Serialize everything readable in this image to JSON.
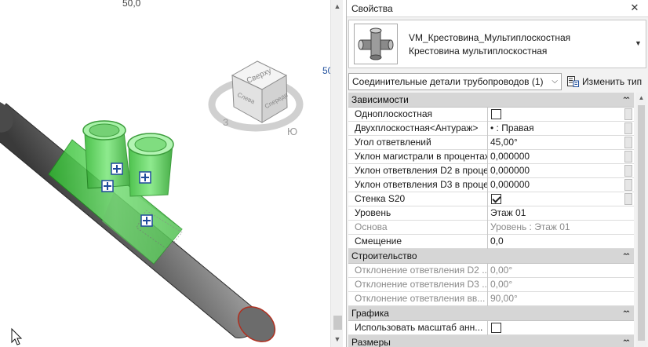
{
  "viewport": {
    "dim_top": "50,0",
    "dim_right": "50",
    "viewcube": {
      "face_top": "Сверху",
      "face_front": "Спереди",
      "face_left": "Слева",
      "compass_west": "З",
      "compass_south": "Ю"
    }
  },
  "properties": {
    "title": "Свойства",
    "type_name_1": "VM_Крестовина_Мультиплоскостная",
    "type_name_2": "Крестовина мультиплоскостная",
    "filter": "Соединительные детали трубопроводов (1)",
    "edit_type": "Изменить тип",
    "groups": [
      {
        "label": "Зависимости",
        "rows": [
          {
            "name": "Одноплоскостная",
            "type": "checkbox",
            "checked": false,
            "disabled": false
          },
          {
            "name": "Двухплоскостная<Антураж>",
            "value": "• : Правая",
            "disabled": false
          },
          {
            "name": "Угол ответвлений",
            "value": "45,00°",
            "disabled": false
          },
          {
            "name": "Уклон магистрали в процентах",
            "value": "0,000000",
            "disabled": false
          },
          {
            "name": "Уклон ответвления D2 в процентах",
            "value": "0,000000",
            "disabled": false
          },
          {
            "name": "Уклон ответвления D3 в процентах",
            "value": "0,000000",
            "disabled": false
          },
          {
            "name": "Стенка S20",
            "type": "checkbox",
            "checked": true,
            "disabled": false
          },
          {
            "name": "Уровень",
            "value": "Этаж 01",
            "disabled": false
          },
          {
            "name": "Основа",
            "value": "Уровень : Этаж 01",
            "disabled": true
          },
          {
            "name": "Смещение",
            "value": "0,0",
            "disabled": false
          }
        ]
      },
      {
        "label": "Строительство",
        "rows": [
          {
            "name": "Отклонение ответвления D2 ...",
            "value": "0,00°",
            "disabled": true
          },
          {
            "name": "Отклонение ответвления D3 ...",
            "value": "0,00°",
            "disabled": true
          },
          {
            "name": "Отклонение ответвления вв...",
            "value": "90,00°",
            "disabled": true
          }
        ]
      },
      {
        "label": "Графика",
        "rows": [
          {
            "name": "Использовать масштаб анн...",
            "type": "checkbox",
            "checked": false,
            "disabled": false
          }
        ]
      },
      {
        "label": "Размеры",
        "rows": []
      }
    ]
  }
}
